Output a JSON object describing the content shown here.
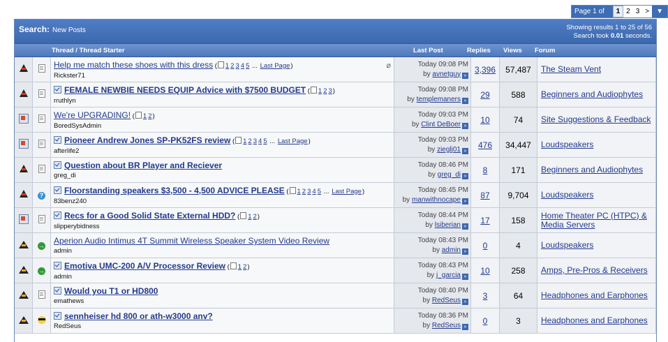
{
  "pager": {
    "label": "Page 1 of 3",
    "current": "1",
    "pages": [
      "2",
      "3"
    ],
    "next": ">",
    "menu": "▼"
  },
  "header": {
    "title": "Search:",
    "subtitle": "New Posts",
    "showing": "Showing results 1 to 25 of 56",
    "took_prefix": "Search took",
    "took_value": "0.01",
    "took_suffix": "seconds."
  },
  "columns": {
    "thread": "Thread / Thread Starter",
    "last_post": "Last Post",
    "replies": "Replies",
    "views": "Views",
    "forum": "Forum"
  },
  "threads": [
    {
      "status": "hot",
      "icon": "doc",
      "bold": false,
      "title": "Help me match these shoes with this dress",
      "pages": [
        "1",
        "2",
        "3",
        "4",
        "5"
      ],
      "last_page": "Last Page",
      "starter": "Rickster71",
      "time": "Today 09:08 PM",
      "by": "by",
      "user": "avnetguy",
      "replies": "3,396",
      "views": "57,487",
      "forum": "The Steam Vent",
      "attach": true
    },
    {
      "status": "hot",
      "icon": "doc",
      "bold": true,
      "title": "FEMALE NEWBIE NEEDS EQUIP Advice with $7500 BUDGET",
      "pages": [
        "1",
        "2",
        "3"
      ],
      "last_page": "",
      "starter": "rruthlyn",
      "time": "Today 09:08 PM",
      "by": "by",
      "user": "templemaners",
      "replies": "29",
      "views": "588",
      "forum": "Beginners and Audiophytes",
      "attach": false
    },
    {
      "status": "note",
      "icon": "doc",
      "bold": false,
      "title": "We're UPGRADING!",
      "pages": [
        "1",
        "2"
      ],
      "last_page": "",
      "starter": "BoredSysAdmin",
      "time": "Today 09:03 PM",
      "by": "by",
      "user": "Clint DeBoer",
      "replies": "10",
      "views": "74",
      "forum": "Site Suggestions & Feedback",
      "attach": false
    },
    {
      "status": "note-hot",
      "icon": "doc",
      "bold": true,
      "title": "Pioneer Andrew Jones SP-PK52FS review",
      "pages": [
        "1",
        "2",
        "3",
        "4",
        "5"
      ],
      "last_page": "Last Page",
      "starter": "afterlife2",
      "time": "Today 09:03 PM",
      "by": "by",
      "user": "zieglj01",
      "replies": "476",
      "views": "34,447",
      "forum": "Loudspeakers",
      "attach": false
    },
    {
      "status": "hot",
      "icon": "doc",
      "bold": true,
      "title": "Question about BR Player and Reciever",
      "pages": [],
      "last_page": "",
      "starter": "greg_di",
      "time": "Today 08:46 PM",
      "by": "by",
      "user": "greg_di",
      "replies": "8",
      "views": "171",
      "forum": "Beginners and Audiophytes",
      "attach": false
    },
    {
      "status": "hot",
      "icon": "question",
      "bold": true,
      "title": "Floorstanding speakers $3,500 - 4,500 ADVICE PLEASE",
      "pages": [
        "1",
        "2",
        "3",
        "4",
        "5"
      ],
      "last_page": "Last Page",
      "starter": "83benz240",
      "time": "Today 08:45 PM",
      "by": "by",
      "user": "manwithnocape",
      "replies": "87",
      "views": "9,704",
      "forum": "Loudspeakers",
      "attach": false
    },
    {
      "status": "note-hot",
      "icon": "doc",
      "bold": true,
      "title": "Recs for a Good Solid State External HDD?",
      "pages": [
        "1",
        "2"
      ],
      "last_page": "",
      "starter": "slipperybidness",
      "time": "Today 08:44 PM",
      "by": "by",
      "user": "lsiberian",
      "replies": "17",
      "views": "158",
      "forum": "Home Theater PC (HTPC) & Media Servers",
      "attach": false
    },
    {
      "status": "plain",
      "icon": "arrow",
      "bold": false,
      "title": "Aperion Audio Intimus 4T Summit Wireless Speaker System Video Review",
      "pages": [],
      "last_page": "",
      "starter": "admin",
      "time": "Today 08:43 PM",
      "by": "by",
      "user": "admin",
      "replies": "0",
      "views": "4",
      "forum": "Loudspeakers",
      "attach": false
    },
    {
      "status": "plain",
      "icon": "arrow",
      "bold": true,
      "title": "Emotiva UMC-200 A/V Processor Review",
      "pages": [
        "1",
        "2"
      ],
      "last_page": "",
      "starter": "admin",
      "time": "Today 08:43 PM",
      "by": "by",
      "user": "j_garcia",
      "replies": "10",
      "views": "258",
      "forum": "Amps, Pre-Pros & Receivers",
      "attach": false
    },
    {
      "status": "plain",
      "icon": "doc",
      "bold": true,
      "title": "Would you T1 or HD800",
      "pages": [],
      "last_page": "",
      "starter": "emathews",
      "time": "Today 08:40 PM",
      "by": "by",
      "user": "RedSeus",
      "replies": "3",
      "views": "64",
      "forum": "Headphones and Earphones",
      "attach": false
    },
    {
      "status": "plain",
      "icon": "cool",
      "bold": true,
      "title": "sennheiser hd 800 or ath-w3000 anv?",
      "pages": [],
      "last_page": "",
      "starter": "RedSeus",
      "time": "Today 08:36 PM",
      "by": "by",
      "user": "RedSeus",
      "replies": "0",
      "views": "3",
      "forum": "Headphones and Earphones",
      "attach": false
    }
  ],
  "icons": {
    "hot": "hot-thread-icon",
    "note": "thread-status-icon",
    "plain": "new-thread-icon",
    "doc": "document-icon",
    "question": "question-icon",
    "arrow": "arrow-right-icon",
    "cool": "sunglasses-smiley-icon",
    "attach": "paperclip-icon",
    "go": "go-to-last-post-icon"
  },
  "colors": {
    "header": "#3c68ae",
    "link": "#233a8e",
    "row_alt": "#e5e8ed"
  }
}
